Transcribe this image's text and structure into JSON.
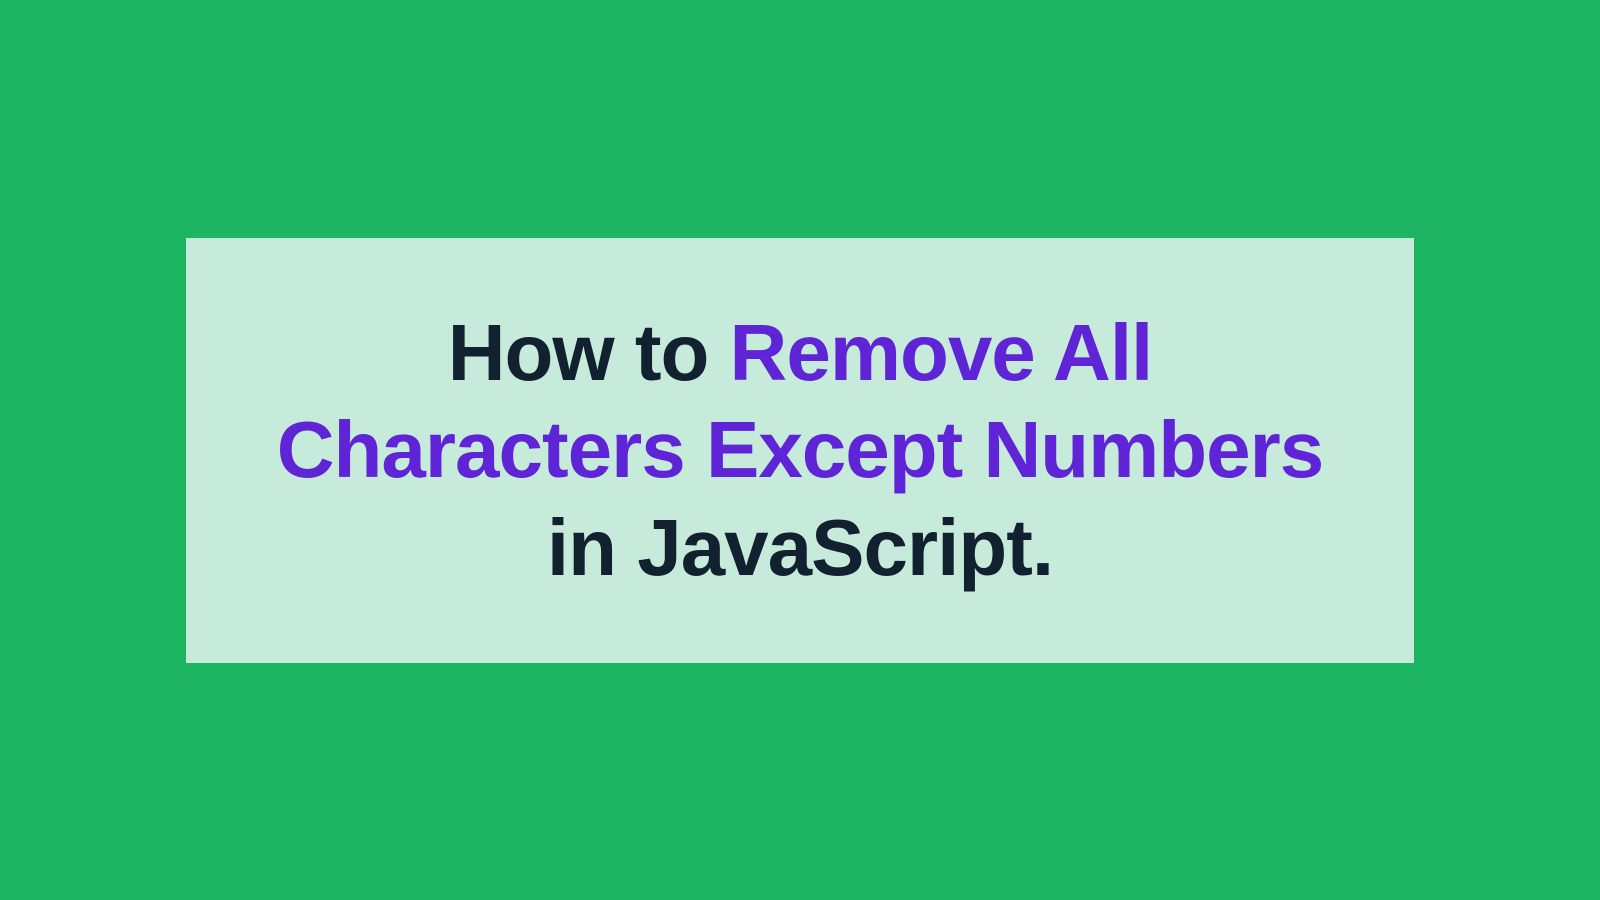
{
  "title": {
    "part1": "How to ",
    "highlight": "Remove All Characters Except Numbers",
    "part2": " in JavaScript."
  }
}
